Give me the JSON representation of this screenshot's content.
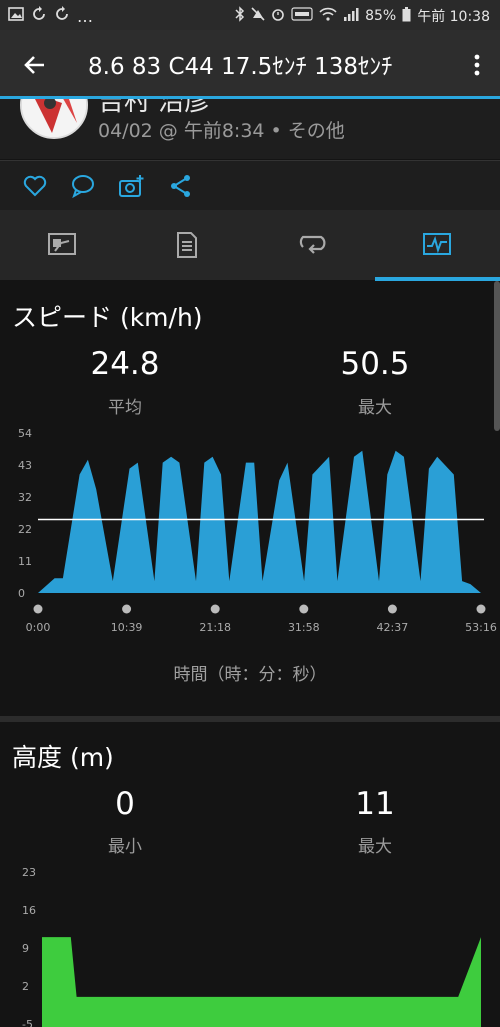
{
  "status_bar": {
    "left_icons": [
      "image-icon",
      "sync-icon",
      "sync-icon",
      "more-icon"
    ],
    "battery": "85%",
    "time": "午前 10:38"
  },
  "toolbar": {
    "title": "8.6 83  C44  17.5ｾﾝﾁ 138ｾﾝﾁ"
  },
  "activity": {
    "name": "吉村 治彦",
    "meta": "04/02 @ 午前8:34 • その他"
  },
  "tabs": [
    "summary-icon",
    "details-icon",
    "laps-icon",
    "charts-icon"
  ],
  "speed": {
    "title": "スピード (km/h)",
    "avg_value": "24.8",
    "avg_label": "平均",
    "max_value": "50.5",
    "max_label": "最大",
    "time_axis_title": "時間（時：分：秒）"
  },
  "elevation": {
    "title": "高度 (m)",
    "min_value": "0",
    "min_label": "最小",
    "max_value": "11",
    "max_label": "最大"
  },
  "colors": {
    "accent": "#2aa7df",
    "speed_fill": "#2a9fd6",
    "elev_fill": "#3ecc3e"
  },
  "chart_data": [
    {
      "type": "area",
      "title": "スピード (km/h)",
      "xlabel": "時間（時：分：秒）",
      "x_ticks": [
        "0:00",
        "10:39",
        "21:18",
        "31:58",
        "42:37",
        "53:16"
      ],
      "y_ticks": [
        "0",
        "11",
        "22",
        "32",
        "43",
        "54"
      ],
      "ylim": [
        0,
        54
      ],
      "average": 24.8,
      "x_minutes": [
        0,
        2,
        3,
        5,
        6,
        7,
        9,
        11,
        12,
        14,
        15,
        16,
        17,
        19,
        20,
        21,
        22,
        23,
        25,
        26,
        27,
        29,
        30,
        32,
        33,
        35,
        36,
        38,
        39,
        41,
        42,
        43,
        44,
        46,
        47,
        48,
        50,
        51,
        52,
        53.27
      ],
      "values": [
        0,
        5,
        5,
        40,
        45,
        35,
        4,
        42,
        44,
        4,
        44,
        46,
        44,
        4,
        44,
        46,
        40,
        4,
        44,
        44,
        4,
        38,
        44,
        4,
        40,
        46,
        4,
        46,
        48,
        4,
        40,
        48,
        46,
        4,
        42,
        46,
        40,
        4,
        3,
        0
      ]
    },
    {
      "type": "area",
      "title": "高度 (m)",
      "y_ticks": [
        "-5",
        "2",
        "9",
        "16",
        "23"
      ],
      "ylim": [
        -12,
        23
      ],
      "x_minutes": [
        0,
        3.5,
        4.2,
        50.5,
        53.27
      ],
      "values": [
        11,
        11,
        0,
        0,
        11
      ]
    }
  ]
}
